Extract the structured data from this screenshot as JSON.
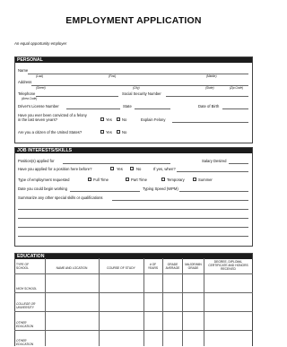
{
  "header": {
    "title": "EMPLOYMENT APPLICATION",
    "eoe": "An equal opportunity employer"
  },
  "personal": {
    "section_title": "PERSONAL",
    "name_label": "Name",
    "name_sub": [
      "(Last)",
      "(First)",
      "(Middle)"
    ],
    "address_label": "Address",
    "address_sub": [
      "(Street)",
      "(City)",
      "(State)",
      "(Zip Code)"
    ],
    "telephone_label": "Telephone",
    "telephone_sub": "(Area Code)",
    "ssn_label": "Social Security Number",
    "license_label": "Driver's License Number",
    "state_label": "State",
    "dob_label": "Date of Birth",
    "felony_q1": "Have you ever been convicted of a felony",
    "felony_q2": "in the last seven years?",
    "yes": "Yes",
    "no": "No",
    "explain_label": "Explain Felony",
    "citizen_q": "Are you a citizen of the United States?"
  },
  "job": {
    "section_title": "JOB INTERESTS/SKILLS",
    "position_label": "Position(s) applied for",
    "salary_label": "Salary Desired",
    "applied_before_q": "Have you applied for a position here before?",
    "yes": "Yes",
    "no": "No",
    "if_yes_label": "If yes, when?",
    "type_label": "Type of employment requested",
    "full_time": "Full Time",
    "part_time": "Part Time",
    "temporary": "Temporary",
    "summer": "Summer",
    "begin_label": "Date you could begin working",
    "typing_label": "Typing Speed (WPM)",
    "summarize_label": "Summarize any other special skills or qualifications"
  },
  "education": {
    "section_title": "EDUCATION",
    "columns": [
      "TYPE OF SCHOOL",
      "NAME AND LOCATION",
      "COURSE OF STUDY",
      "# OF YEARS",
      "GRADE AVERAGE",
      "MAJOR/MIN GRADE",
      "DEGREE, DIPLOMA, CERTIFICATE AND HONORS RECEIVED"
    ],
    "rows": [
      "HIGH SCHOOL",
      "COLLEGE OR UNIVERSITY",
      "OTHER EDUCATION",
      "OTHER EDUCATION"
    ]
  }
}
